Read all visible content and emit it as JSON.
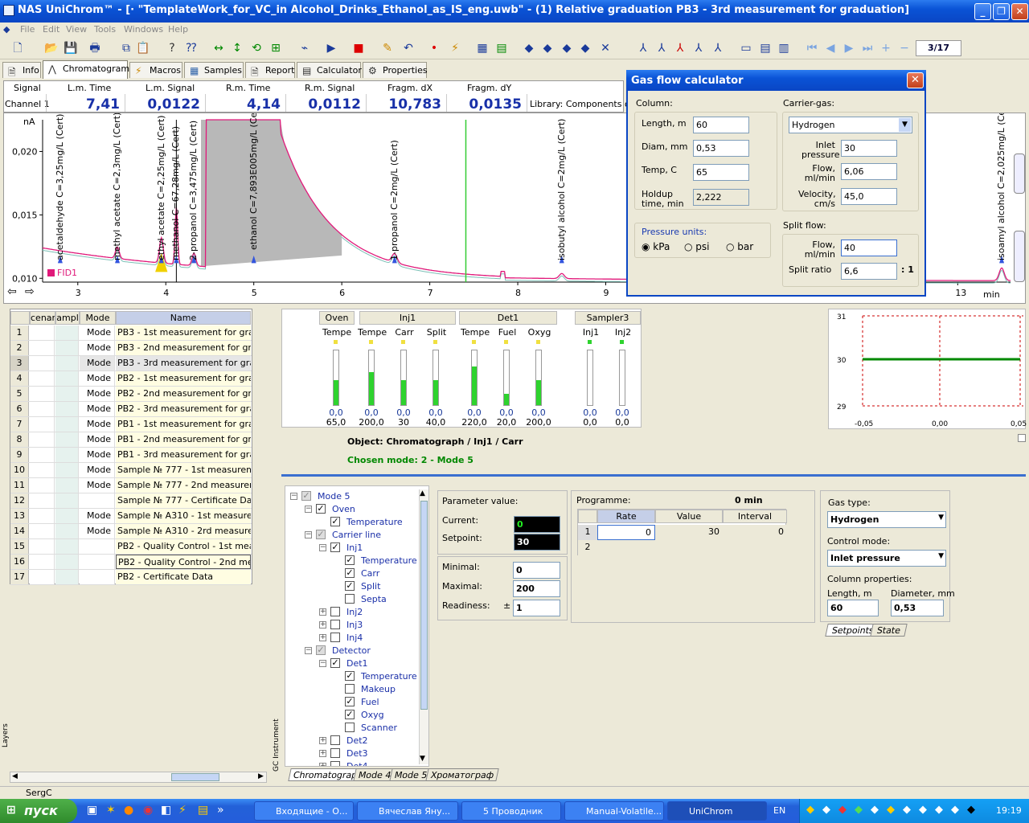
{
  "window": {
    "title": "NAS UniChrom™ - [· \"TemplateWork_for_VC_in Alcohol_Drinks_Ethanol_as_IS_eng.uwb\" - (1) Relative graduation PB3 - 3rd measurement for graduation]",
    "min": "_",
    "max": "❐",
    "close": "✕"
  },
  "menu": [
    "File",
    "Edit",
    "View",
    "Tools",
    "Windows",
    "Help"
  ],
  "toolbar": {
    "pager": "3/17"
  },
  "tabs": [
    "Info",
    "Chromatogram",
    "Macros",
    "Samples",
    "Report",
    "Calculator",
    "Properties"
  ],
  "readout": {
    "headers": [
      "Signal",
      "L.m. Time",
      "L.m. Signal",
      "R.m. Time",
      "R.m. Signal",
      "Fragm. dX",
      "Fragm. dY"
    ],
    "channel": "Channel 1",
    "lm_time": "7,41",
    "lm_signal": "0,0122",
    "rm_time": "4,14",
    "rm_signal": "0,0112",
    "fragm_dx": "10,783",
    "fragm_dy": "0,0135",
    "library": "Library: Components of"
  },
  "chart_data": {
    "type": "line",
    "ylabel": "nA",
    "xlabel": "min",
    "xlim": [
      2.6,
      13.6
    ],
    "ylim": [
      0.0097,
      0.0225
    ],
    "xticks": [
      3,
      4,
      5,
      6,
      7,
      8,
      9,
      10,
      11,
      12,
      13
    ],
    "yticks": [
      "0,020",
      "0,015",
      "0,010"
    ],
    "legend": "FID1",
    "cursor_x": 7.41,
    "peaks": [
      {
        "label": "acetaldehyde C=3,25mg/L (Cert)",
        "x": 2.8
      },
      {
        "label": "methyl acetate C=2,3mg/L (Cert)",
        "x": 3.45
      },
      {
        "label": "ethyl acetate C=2,25mg/L (Cert)",
        "x": 3.95
      },
      {
        "label": "methanol C=67,28mg/L (Cert)",
        "x": 4.12
      },
      {
        "label": "2-propanol C=3,475mg/L (Cert)",
        "x": 4.32
      },
      {
        "label": "ethanol C=7,893E005mg/L (Cert)",
        "x": 5.0
      },
      {
        "label": "1-propanol C=2mg/L (Cert)",
        "x": 6.6
      },
      {
        "label": "isobutyl alcohol C=2mg/L (Cert)",
        "x": 8.5
      },
      {
        "label": "isoamyl alcohol C=2,025mg/L (Cert)",
        "x": 13.5
      }
    ]
  },
  "gas_calc": {
    "title": "Gas flow calculator",
    "column_label": "Column:",
    "length_label": "Length, m",
    "length": "60",
    "diam_label": "Diam, mm",
    "diam": "0,53",
    "temp_label": "Temp, C",
    "temp": "65",
    "holdup_label": "Holdup time, min",
    "holdup": "2,222",
    "pressure_units_label": "Pressure units:",
    "units": [
      "kPa",
      "psi",
      "bar"
    ],
    "carrier_label": "Carrier-gas:",
    "carrier": "Hydrogen",
    "inlet_label": "Inlet pressure",
    "inlet": "30",
    "flow_label": "Flow, ml/min",
    "flow": "6,06",
    "velocity_label": "Velocity, cm/s",
    "velocity": "45,0",
    "split_label": "Split flow:",
    "split_flow_label": "Flow, ml/min",
    "split_flow": "40",
    "split_ratio_label": "Split ratio",
    "split_ratio": "6,6",
    "ratio_suffix": ": 1"
  },
  "table": {
    "headers": [
      "",
      "cenar",
      "ampl",
      "Mode",
      "Name"
    ],
    "rows": [
      {
        "n": "1",
        "mode": "Mode 5",
        "name": "PB3 - 1st measurement for gradua"
      },
      {
        "n": "2",
        "mode": "Mode 5",
        "name": "PB3 - 2nd measurement for gradu"
      },
      {
        "n": "3",
        "mode": "Mode 5",
        "name": "PB3 - 3rd measurement for gradua"
      },
      {
        "n": "4",
        "mode": "Mode 5",
        "name": "PB2 - 1st measurement for gradua"
      },
      {
        "n": "5",
        "mode": "Mode 5",
        "name": "PB2 - 2nd measurement for gradu"
      },
      {
        "n": "6",
        "mode": "Mode 5",
        "name": "PB2 - 3rd measurement for gradua"
      },
      {
        "n": "7",
        "mode": "Mode 5",
        "name": "PB1 - 1st measurement for gradua"
      },
      {
        "n": "8",
        "mode": "Mode 5",
        "name": "PB1 - 2nd measurement for gradu"
      },
      {
        "n": "9",
        "mode": "Mode 5",
        "name": "PB1 - 3rd measurement for gradua"
      },
      {
        "n": "10",
        "mode": "Mode 5",
        "name": "Sample № 777 - 1st measurement"
      },
      {
        "n": "11",
        "mode": "Mode 5",
        "name": "Sample № 777 - 2nd measuremer"
      },
      {
        "n": "12",
        "mode": "",
        "name": "Sample № 777 - Certificate Data"
      },
      {
        "n": "13",
        "mode": "Mode 5",
        "name": "Sample № A310 - 1st measureme"
      },
      {
        "n": "14",
        "mode": "Mode 5",
        "name": "Sample № A310 - 2rd measureme"
      },
      {
        "n": "15",
        "mode": "",
        "name": "PB2 - Quality Control - 1st measu"
      },
      {
        "n": "16",
        "mode": "",
        "name": "PB2 - Quality Control - 2nd me"
      },
      {
        "n": "17",
        "mode": "",
        "name": "PB2 - Certificate Data"
      }
    ]
  },
  "instrument": {
    "groups": [
      "Oven",
      "Inj1",
      "Det1",
      "Sampler3"
    ],
    "columns": [
      {
        "name": "Temper",
        "v1": "0,0",
        "v2": "65,0",
        "fill": 0.45
      },
      {
        "name": "Temper",
        "v1": "0,0",
        "v2": "200,0",
        "fill": 0.6
      },
      {
        "name": "Carr",
        "v1": "0,0",
        "v2": "30",
        "fill": 0.45
      },
      {
        "name": "Split",
        "v1": "0,0",
        "v2": "40,0",
        "fill": 0.45
      },
      {
        "name": "Temper",
        "v1": "0,0",
        "v2": "220,0",
        "fill": 0.7
      },
      {
        "name": "Fuel",
        "v1": "0,0",
        "v2": "20,0",
        "fill": 0.2
      },
      {
        "name": "Oxyg",
        "v1": "0,0",
        "v2": "200,0",
        "fill": 0.45
      },
      {
        "name": "Inj1",
        "v1": "0,0",
        "v2": "0,0",
        "fill": 0
      },
      {
        "name": "Inj2",
        "v1": "0,0",
        "v2": "0,0",
        "fill": 0
      }
    ]
  },
  "miniplot": {
    "yticks": [
      "31",
      "30",
      "29"
    ],
    "xticks": [
      "-0,05",
      "0,00",
      "0,05"
    ]
  },
  "object": {
    "path": "Object: Chromatograph / Inj1 / Carr",
    "mode": "Chosen mode: 2 - Mode 5"
  },
  "tree": {
    "items": [
      {
        "label": "Mode 5",
        "lvl": 0,
        "exp": "−",
        "chk": "g"
      },
      {
        "label": "Oven",
        "lvl": 1,
        "exp": "−",
        "chk": "1"
      },
      {
        "label": "Temperature",
        "lvl": 2,
        "exp": "",
        "chk": "1"
      },
      {
        "label": "Carrier line",
        "lvl": 1,
        "exp": "−",
        "chk": "g"
      },
      {
        "label": "Inj1",
        "lvl": 2,
        "exp": "−",
        "chk": "1"
      },
      {
        "label": "Temperature",
        "lvl": 3,
        "exp": "",
        "chk": "1"
      },
      {
        "label": "Carr",
        "lvl": 3,
        "exp": "",
        "chk": "1"
      },
      {
        "label": "Split",
        "lvl": 3,
        "exp": "",
        "chk": "1"
      },
      {
        "label": "Septa",
        "lvl": 3,
        "exp": "",
        "chk": "0"
      },
      {
        "label": "Inj2",
        "lvl": 2,
        "exp": "+",
        "chk": "0"
      },
      {
        "label": "Inj3",
        "lvl": 2,
        "exp": "+",
        "chk": "0"
      },
      {
        "label": "Inj4",
        "lvl": 2,
        "exp": "+",
        "chk": "0"
      },
      {
        "label": "Detector",
        "lvl": 1,
        "exp": "−",
        "chk": "g"
      },
      {
        "label": "Det1",
        "lvl": 2,
        "exp": "−",
        "chk": "1"
      },
      {
        "label": "Temperature",
        "lvl": 3,
        "exp": "",
        "chk": "1"
      },
      {
        "label": "Makeup",
        "lvl": 3,
        "exp": "",
        "chk": "0"
      },
      {
        "label": "Fuel",
        "lvl": 3,
        "exp": "",
        "chk": "1"
      },
      {
        "label": "Oxyg",
        "lvl": 3,
        "exp": "",
        "chk": "1"
      },
      {
        "label": "Scanner",
        "lvl": 3,
        "exp": "",
        "chk": "0"
      },
      {
        "label": "Det2",
        "lvl": 2,
        "exp": "+",
        "chk": "0"
      },
      {
        "label": "Det3",
        "lvl": 2,
        "exp": "+",
        "chk": "0"
      },
      {
        "label": "Det4",
        "lvl": 2,
        "exp": "+",
        "chk": "0"
      }
    ]
  },
  "param": {
    "title": "Parameter value:",
    "current_label": "Current:",
    "current": "0",
    "setpoint_label": "Setpoint:",
    "setpoint": "30",
    "min_label": "Minimal:",
    "min": "0",
    "max_label": "Maximal:",
    "max": "200",
    "ready_label": "Readiness:",
    "ready_pm": "±",
    "ready": "1"
  },
  "programme": {
    "title": "Programme:",
    "time": "0 min",
    "headers": [
      "Rate",
      "Value",
      "Interval"
    ],
    "rows": [
      {
        "n": "1",
        "rate": "0",
        "value": "30",
        "interval": "0"
      },
      {
        "n": "2",
        "rate": "",
        "value": "",
        "interval": ""
      }
    ]
  },
  "gasprops": {
    "gas_type_label": "Gas type:",
    "gas_type": "Hydrogen",
    "control_label": "Control mode:",
    "control": "Inlet pressure",
    "colprops_label": "Column properties:",
    "length_label": "Length, m",
    "length": "60",
    "diam_label": "Diameter, mm",
    "diam": "0,53",
    "tabs": [
      "Setpoints",
      "State"
    ]
  },
  "bottom_tabs": [
    "Chromatograph",
    "Mode 4",
    "Mode 5",
    "Хроматограф"
  ],
  "side_labels": {
    "layers": "Layers",
    "gc": "GC Instrument"
  },
  "status": "SergC",
  "taskbar": {
    "start": "пуск",
    "tasks": [
      "Входящие - О...",
      "Вячеслав Яну...",
      "5 Проводник",
      "Manual-Volatile...",
      "UniChrom"
    ],
    "lang": "EN",
    "clock": "19:19"
  }
}
